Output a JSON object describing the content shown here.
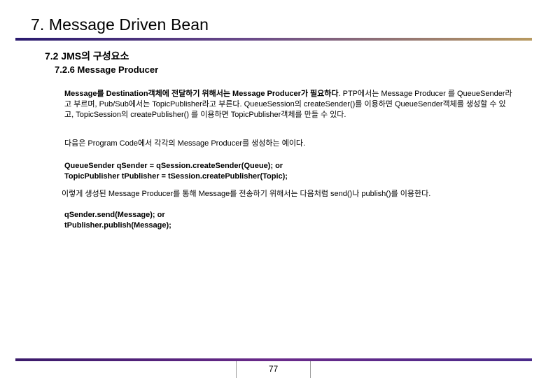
{
  "slide": {
    "title": "7. Message Driven Bean",
    "section": "7.2 JMS의 구성요소",
    "subsection": "7.2.6 Message Producer",
    "p1_bold": "Message를 Destination객체에 전달하기 위해서는 Message Producer가 필요하다",
    "p1_rest": ". PTP에서는 Message Producer 를 QueueSender라고 부르며, Pub/Sub에서는 TopicPublisher라고 부른다. QueueSession의 createSender()를 이용하면 QueueSender객체를 생성할 수 있고, TopicSession의 createPublisher() 를 이용하면 TopicPublisher객체를 만들 수 있다.",
    "p2": "다음은 Program Code에서 각각의 Message Producer를 생성하는 예이다.",
    "code1_line1": "QueueSender qSender = qSession.createSender(Queue); or",
    "code1_line2": "TopicPublisher tPublisher = tSession.createPublisher(Topic);",
    "p4": "이렇게 생성된 Message Producer를 통해 Message를 전송하기 위해서는 다음처럼 send()나 publish()를 이용한다.",
    "code2_line1": "qSender.send(Message); or",
    "code2_line2": "tPublisher.publish(Message);",
    "page_number": "77"
  }
}
